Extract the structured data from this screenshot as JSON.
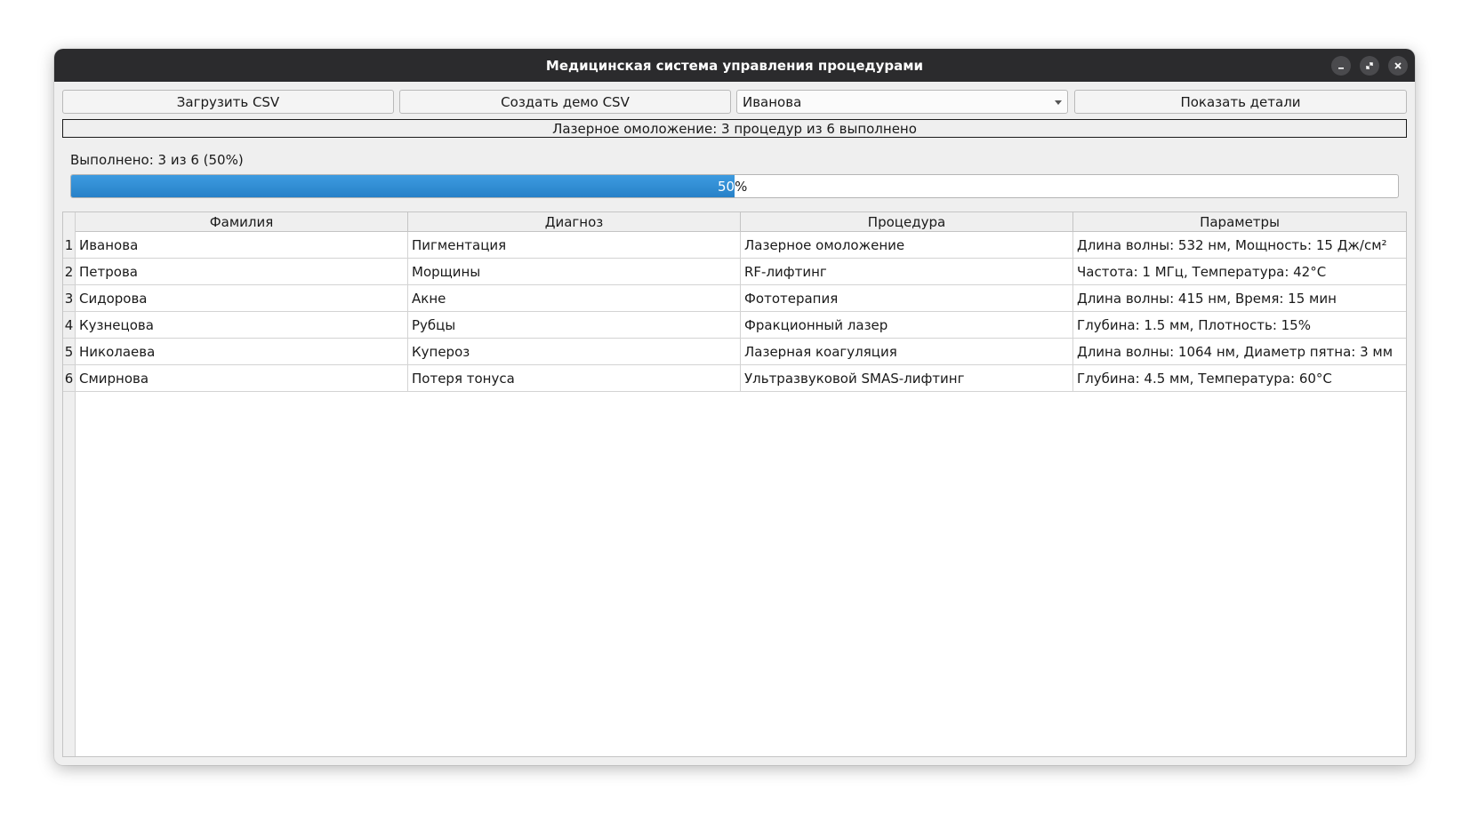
{
  "window": {
    "title": "Медицинская система управления процедурами"
  },
  "toolbar": {
    "load_csv_label": "Загрузить CSV",
    "create_demo_label": "Создать демо CSV",
    "patient_select_value": "Иванова",
    "show_details_label": "Показать детали"
  },
  "status": {
    "summary": "Лазерное омоложение: 3 процедур из 6 выполнено",
    "done_label": "Выполнено: 3 из 6 (50%)",
    "progress_percent": 50,
    "progress_text_inner": "50",
    "progress_text_outer": "%"
  },
  "table": {
    "columns": [
      "Фамилия",
      "Диагноз",
      "Процедура",
      "Параметры"
    ],
    "rows": [
      {
        "num": "1",
        "surname": "Иванова",
        "diagnosis": "Пигментация",
        "procedure": "Лазерное омоложение",
        "params": "Длина волны: 532 нм, Мощность: 15 Дж/см²"
      },
      {
        "num": "2",
        "surname": "Петрова",
        "diagnosis": "Морщины",
        "procedure": "RF-лифтинг",
        "params": "Частота: 1 МГц, Температура: 42°C"
      },
      {
        "num": "3",
        "surname": "Сидорова",
        "diagnosis": "Акне",
        "procedure": "Фототерапия",
        "params": "Длина волны: 415 нм, Время: 15 мин"
      },
      {
        "num": "4",
        "surname": "Кузнецова",
        "diagnosis": "Рубцы",
        "procedure": "Фракционный лазер",
        "params": "Глубина: 1.5 мм, Плотность: 15%"
      },
      {
        "num": "5",
        "surname": "Николаева",
        "diagnosis": "Купероз",
        "procedure": "Лазерная коагуляция",
        "params": "Длина волны: 1064 нм, Диаметр пятна: 3 мм"
      },
      {
        "num": "6",
        "surname": "Смирнова",
        "diagnosis": "Потеря тонуса",
        "procedure": "Ультразвуковой SMAS-лифтинг",
        "params": "Глубина: 4.5 мм, Температура: 60°C"
      }
    ]
  },
  "colors": {
    "titlebar": "#2b2b2d",
    "progress_fill": "#3d9be0"
  },
  "icons": {
    "minimize": "minimize-icon",
    "maximize": "maximize-icon",
    "close": "close-icon",
    "dropdown": "chevron-down-icon"
  }
}
